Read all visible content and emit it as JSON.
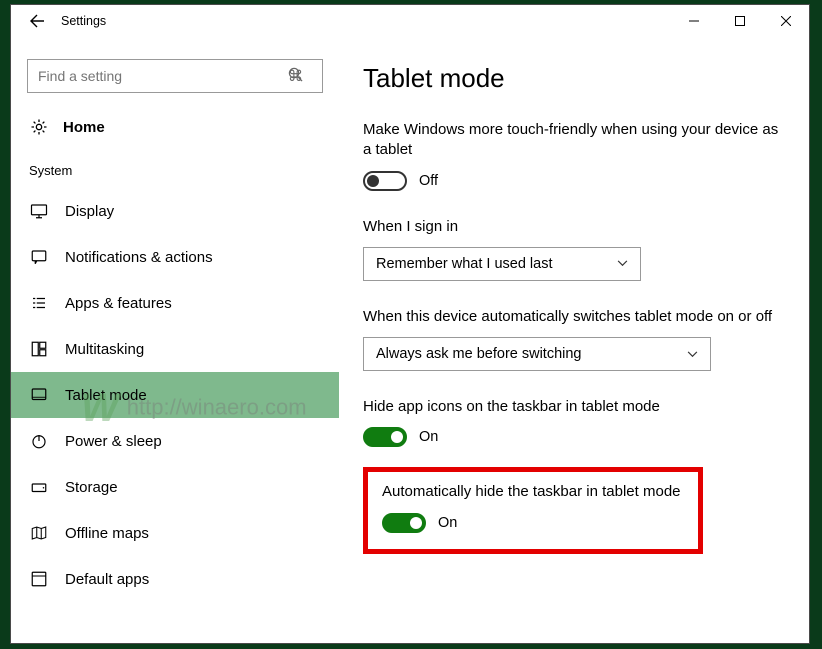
{
  "window": {
    "title": "Settings"
  },
  "search": {
    "placeholder": "Find a setting"
  },
  "home": {
    "label": "Home"
  },
  "section": "System",
  "nav": [
    {
      "id": "display",
      "label": "Display"
    },
    {
      "id": "notifications",
      "label": "Notifications & actions"
    },
    {
      "id": "apps",
      "label": "Apps & features"
    },
    {
      "id": "multitasking",
      "label": "Multitasking"
    },
    {
      "id": "tabletmode",
      "label": "Tablet mode"
    },
    {
      "id": "power",
      "label": "Power & sleep"
    },
    {
      "id": "storage",
      "label": "Storage"
    },
    {
      "id": "offlinemaps",
      "label": "Offline maps"
    },
    {
      "id": "defaultapps",
      "label": "Default apps"
    }
  ],
  "page": {
    "title": "Tablet mode",
    "touch": {
      "label": "Make Windows more touch-friendly when using your device as a tablet",
      "value": "Off",
      "on": false
    },
    "signin": {
      "label": "When I sign in",
      "value": "Remember what I used last"
    },
    "switch": {
      "label": "When this device automatically switches tablet mode on or off",
      "value": "Always ask me before switching"
    },
    "hideicons": {
      "label": "Hide app icons on the taskbar in tablet mode",
      "value": "On",
      "on": true
    },
    "autohide": {
      "label": "Automatically hide the taskbar in tablet mode",
      "value": "On",
      "on": true
    }
  },
  "watermark": "http://winaero.com"
}
